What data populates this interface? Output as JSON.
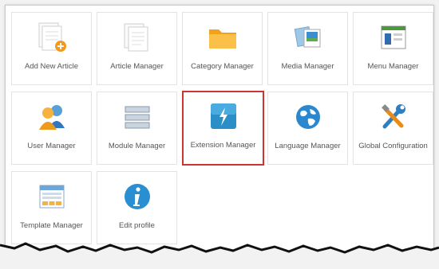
{
  "tiles": [
    {
      "label": "Add New Article",
      "icon": "add-article-icon"
    },
    {
      "label": "Article Manager",
      "icon": "article-manager-icon"
    },
    {
      "label": "Category Manager",
      "icon": "folder-icon"
    },
    {
      "label": "Media Manager",
      "icon": "media-icon"
    },
    {
      "label": "Menu Manager",
      "icon": "menu-manager-icon"
    },
    {
      "label": "User Manager",
      "icon": "users-icon"
    },
    {
      "label": "Module Manager",
      "icon": "module-icon"
    },
    {
      "label": "Extension Manager",
      "icon": "lightning-icon",
      "selected": true
    },
    {
      "label": "Language Manager",
      "icon": "globe-icon"
    },
    {
      "label": "Global Configuration",
      "icon": "tools-icon"
    },
    {
      "label": "Template Manager",
      "icon": "template-icon"
    },
    {
      "label": "Edit profile",
      "icon": "info-icon"
    }
  ],
  "colors": {
    "selection_border": "#cc3333",
    "lightning_blue": "#2a8fc7",
    "folder_orange": "#f5a623"
  }
}
